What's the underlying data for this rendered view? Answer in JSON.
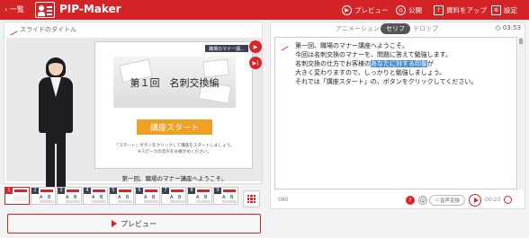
{
  "header": {
    "back_label": "一覧",
    "brand": "PIP-Maker",
    "preview_label": "プレビュー",
    "publish_label": "公開",
    "upload_label": "資料をアップ",
    "settings_label": "設定",
    "back_icon": "chevron-left-icon",
    "colors": {
      "header_bg": "#d32327",
      "accent": "#d9252a"
    }
  },
  "left": {
    "slide_title_placeholder": "スライドのタイトル",
    "slide": {
      "header_tag": "職場のマナー講...",
      "banner_text": "第１回　名刺交換編",
      "start_button": "講座スタート",
      "note_line1": "「スタート」ボタンをクリックして講座をスタートしましょう。",
      "note_line2": "※スピーカの音声をお確かめください。"
    },
    "caption": "第一回、職場のマナー講座へようこそ。",
    "thumbnails": [
      {
        "num": "1"
      },
      {
        "num": "2",
        "l1": "A",
        "l2": "B"
      },
      {
        "num": "3",
        "l1": "A",
        "l2": "B"
      },
      {
        "num": "4",
        "l1": "A",
        "l2": "B"
      },
      {
        "num": "5",
        "l1": "A",
        "l2": "B"
      },
      {
        "num": "6",
        "l1": "A",
        "l2": "B"
      },
      {
        "num": "7",
        "l1": "A",
        "l2": "B"
      },
      {
        "num": "8",
        "l1": "A",
        "l2": "B"
      },
      {
        "num": "9",
        "l1": "A",
        "l2": "B"
      }
    ]
  },
  "preview_button": "プレビュー",
  "right": {
    "tabs": [
      "アニメーション",
      "セリフ",
      "テロップ"
    ],
    "active_tab": "セリフ",
    "duration": "03:53",
    "script_lines": [
      "第一回、職場のマナー講座へようこそ。",
      "今回は名刺交換のマナーを、問題に答えて勉強します。",
      "名刺交換の仕方でお客様の",
      "あなたに対する印象",
      "が",
      "大きく変わりますので、しっかりと勉強しましょう。",
      "それでは「講座スタート」の、ボタンをクリックしてください。"
    ],
    "char_count": "080",
    "voice_button": "音声変換",
    "play_time": "00:23"
  }
}
